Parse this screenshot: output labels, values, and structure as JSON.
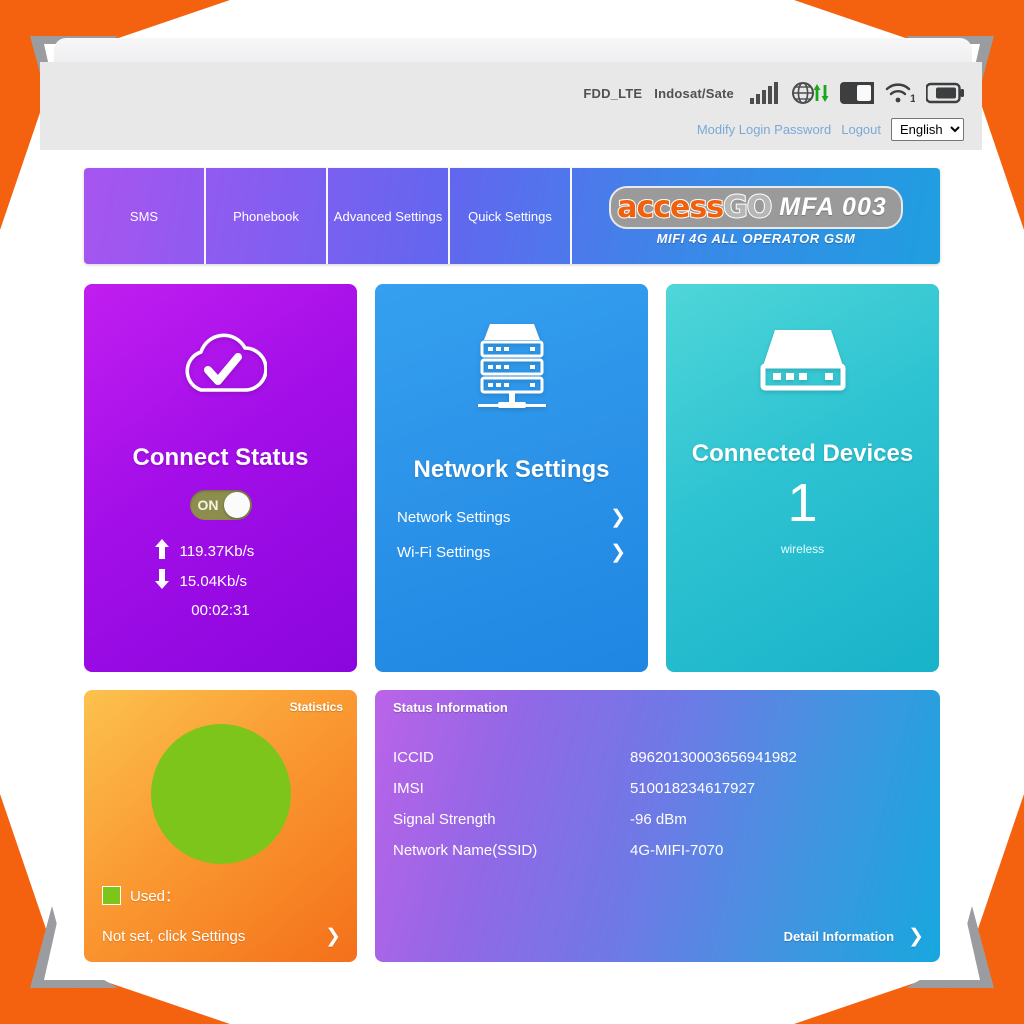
{
  "header": {
    "network_mode": "FDD_LTE",
    "carrier": "Indosat/Sate",
    "icons": [
      "signal-bars-icon",
      "globe-data-transfer-icon",
      "sim-card-icon",
      "wifi-icon",
      "battery-icon"
    ],
    "wifi_client_count": "1",
    "modify_password_link": "Modify Login Password",
    "logout_link": "Logout",
    "language_selected": "English",
    "language_options": [
      "English"
    ]
  },
  "nav": {
    "tabs": [
      {
        "label": "SMS"
      },
      {
        "label": "Phonebook"
      },
      {
        "label": "Advanced Settings"
      },
      {
        "label": "Quick Settings"
      }
    ],
    "brand": {
      "name_part1": "access",
      "name_part2": "GO",
      "model": "MFA 003",
      "tagline": "MIFI 4G ALL OPERATOR GSM"
    }
  },
  "connect_card": {
    "icon": "cloud-check-icon",
    "title": "Connect Status",
    "toggle_label": "ON",
    "toggle_state": "on",
    "upload_arrow": "⬆",
    "upload_speed": "119.37Kb/s",
    "download_arrow": "⬇",
    "download_speed": "15.04Kb/s",
    "connected_time": "00:02:31"
  },
  "network_card": {
    "icon": "server-rack-icon",
    "title": "Network Settings",
    "links": [
      {
        "label": "Network Settings"
      },
      {
        "label": "Wi-Fi Settings"
      }
    ]
  },
  "devices_card": {
    "icon": "router-device-icon",
    "title": "Connected Devices",
    "count": "1",
    "type_label": "wireless"
  },
  "statistics_card": {
    "title": "Statistics",
    "legend_label": "Used：",
    "footer_label": "Not set, click Settings",
    "chart_color": "#7dc51a"
  },
  "status_card": {
    "title": "Status Information",
    "rows": [
      {
        "label": "ICCID",
        "value": "89620130003656941982"
      },
      {
        "label": "IMSI",
        "value": "510018234617927"
      },
      {
        "label": "Signal Strength",
        "value": "-96 dBm"
      },
      {
        "label": "Network Name(SSID)",
        "value": "4G-MIFI-7070"
      }
    ],
    "detail_link": "Detail Information"
  },
  "chart_data": {
    "type": "pie",
    "title": "Statistics",
    "categories": [
      "Used"
    ],
    "values": [
      100
    ],
    "colors": [
      "#7dc51a"
    ],
    "legend": [
      "Used："
    ],
    "annotation": "Not set, click Settings"
  }
}
